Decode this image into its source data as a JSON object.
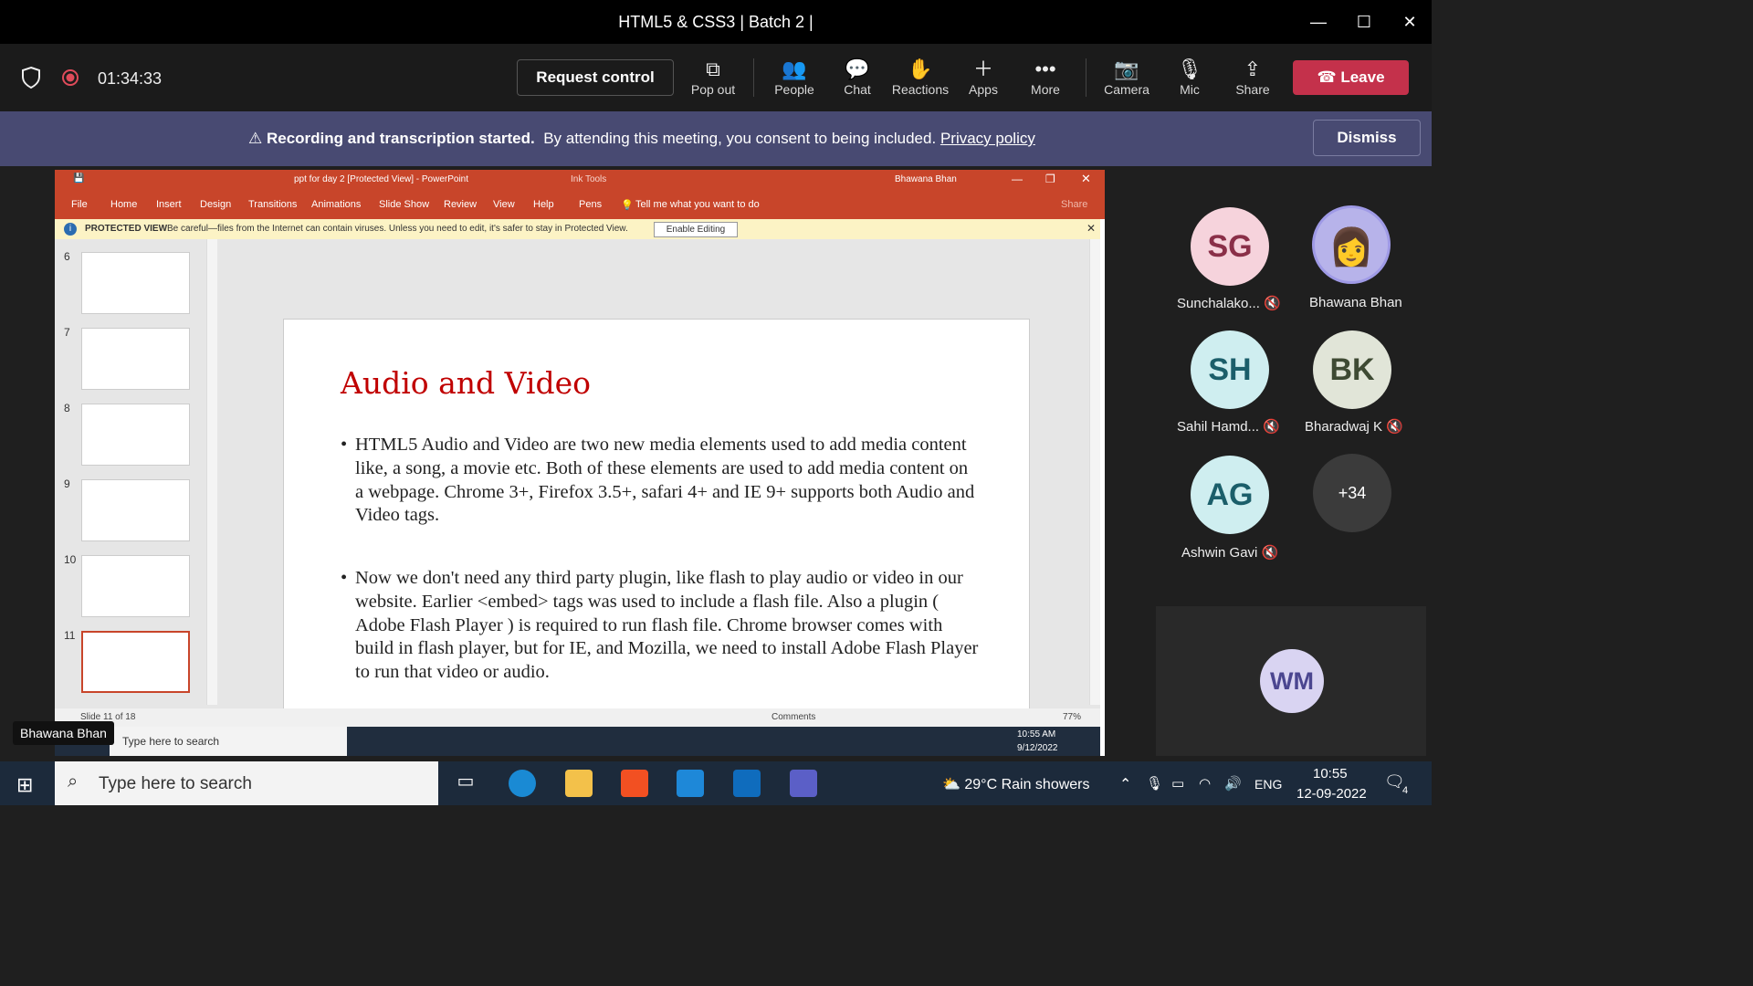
{
  "window": {
    "title": "HTML5 & CSS3 | Batch 2 |"
  },
  "toolbar": {
    "timer": "01:34:33",
    "request_control": "Request control",
    "items": [
      {
        "label": "Pop out",
        "icon": "pop-out-icon"
      },
      {
        "label": "People",
        "icon": "people-icon"
      },
      {
        "label": "Chat",
        "icon": "chat-icon"
      },
      {
        "label": "Reactions",
        "icon": "reactions-icon"
      },
      {
        "label": "Apps",
        "icon": "apps-icon"
      },
      {
        "label": "More",
        "icon": "more-icon"
      },
      {
        "label": "Camera",
        "icon": "camera-off-icon"
      },
      {
        "label": "Mic",
        "icon": "mic-off-icon"
      },
      {
        "label": "Share",
        "icon": "share-icon"
      }
    ],
    "leave": "Leave",
    "leave_color": "#c4314b"
  },
  "banner": {
    "bold": "Recording and transcription started.",
    "text": "By attending this meeting, you consent to being included.",
    "link": "Privacy policy",
    "dismiss": "Dismiss"
  },
  "powerpoint": {
    "title": "ppt for day 2 [Protected View] - PowerPoint",
    "ink_tools": "Ink Tools",
    "user": "Bhawana Bhan",
    "tabs": [
      "File",
      "Home",
      "Insert",
      "Design",
      "Transitions",
      "Animations",
      "Slide Show",
      "Review",
      "View",
      "Help",
      "Pens"
    ],
    "tell_me": "Tell me what you want to do",
    "share": "Share",
    "protected_label": "PROTECTED VIEW",
    "protected_text": "Be careful—files from the Internet can contain viruses. Unless you need to edit, it's safer to stay in Protected View.",
    "enable_editing": "Enable Editing",
    "thumb_numbers": [
      "6",
      "7",
      "8",
      "9",
      "10",
      "11"
    ],
    "status_slide": "Slide 11 of 18",
    "comments": "Comments",
    "zoom": "77%",
    "accent": "#c8452a"
  },
  "slide": {
    "title": "Audio and Video",
    "bullet1": "HTML5 Audio and Video are two new media elements used to add media content like, a song, a movie etc. Both of these elements are used to add media content on a webpage. Chrome 3+, Firefox 3.5+, safari 4+ and IE 9+ supports both Audio and Video tags.",
    "bullet2": "Now we don't need any third party plugin, like flash to play audio or video in our website. Earlier <embed> tags was used to include a flash file. Also a plugin ( Adobe Flash Player ) is required to run flash file. Chrome browser comes with build in flash player, but for IE, and Mozilla, we need to install Adobe Flash Player to run that video or audio."
  },
  "inner_taskbar": {
    "search_placeholder": "Type here to search",
    "time": "10:55 AM",
    "date": "9/12/2022"
  },
  "presenter_label": "Bhawana Bhan",
  "participants": [
    {
      "initials": "SG",
      "name": "Sunchalako...",
      "muted": true,
      "color": "#f6d3dc",
      "text_color": "#8a2f48"
    },
    {
      "initials": "",
      "name": "Bhawana Bhan",
      "muted": false,
      "color": "#b7b3ea",
      "text_color": "#333"
    },
    {
      "initials": "SH",
      "name": "Sahil Hamd...",
      "muted": true,
      "color": "#cfeef0",
      "text_color": "#1b5e6a"
    },
    {
      "initials": "BK",
      "name": "Bharadwaj K",
      "muted": true,
      "color": "#e1e5d8",
      "text_color": "#3e4a33"
    },
    {
      "initials": "AG",
      "name": "Ashwin Gavi",
      "muted": true,
      "color": "#cfeef0",
      "text_color": "#1b5e6a"
    },
    {
      "initials": "+34",
      "name": "",
      "muted": false,
      "color": "#3b3b3b",
      "text_color": "#fff"
    }
  ],
  "self_tile": {
    "initials": "WM",
    "color": "#d9d4f2",
    "text_color": "#4b4690"
  },
  "taskbar": {
    "search_placeholder": "Type here to search",
    "weather": "29°C  Rain showers",
    "lang": "ENG",
    "time": "10:55",
    "date": "12-09-2022",
    "notifications": "4"
  }
}
